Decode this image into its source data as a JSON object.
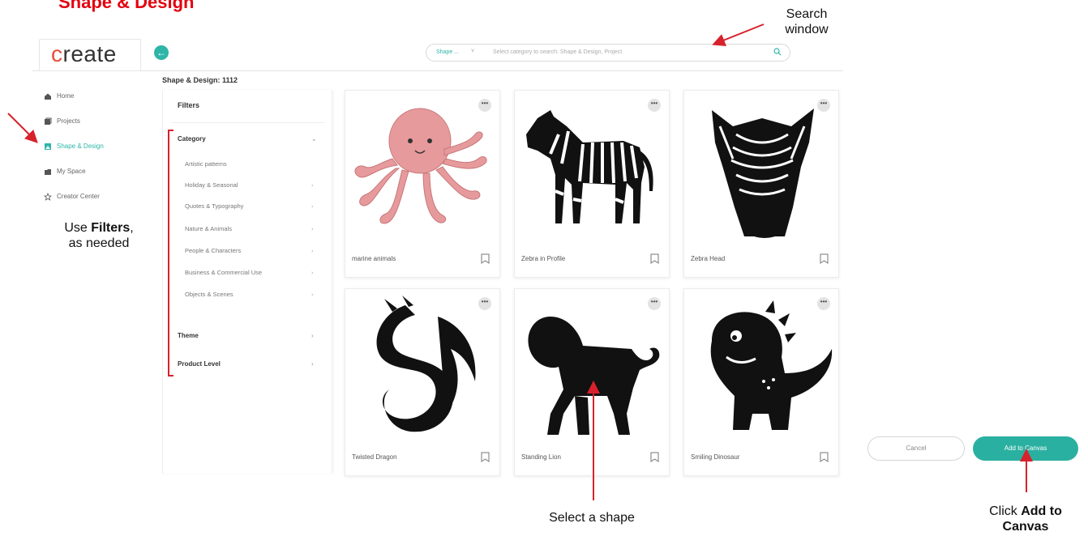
{
  "doc_title": "Shape & Design",
  "app": {
    "logo": "create",
    "search": {
      "category": "Shape ...",
      "placeholder": "Select category to search: Shape & Design, Project"
    }
  },
  "sidebar": {
    "items": [
      {
        "label": "Home",
        "icon": "home-icon"
      },
      {
        "label": "Projects",
        "icon": "projects-icon"
      },
      {
        "label": "Shape & Design",
        "icon": "shape-icon",
        "active": true
      },
      {
        "label": "My Space",
        "icon": "folder-icon"
      },
      {
        "label": "Creator Center",
        "icon": "star-icon"
      }
    ]
  },
  "breadcrumb": "Shape & Design:  1112",
  "filters": {
    "title": "Filters",
    "category_label": "Category",
    "categories": [
      "Artistic patterns",
      "Holiday & Seasonal",
      "Quotes & Typography",
      "Nature & Animals",
      "People & Characters",
      "Business & Commercial Use",
      "Objects & Scenes"
    ],
    "theme_label": "Theme",
    "product_level_label": "Product Level"
  },
  "cards": [
    {
      "name": "marine animals"
    },
    {
      "name": "Zebra in Profile"
    },
    {
      "name": "Zebra Head"
    },
    {
      "name": "Twisted Dragon"
    },
    {
      "name": "Standing Lion"
    },
    {
      "name": "Smiling Dinosaur"
    }
  ],
  "more_glyph": "•••",
  "buttons": {
    "cancel": "Cancel",
    "add": "Add to Canvas"
  },
  "annotations": {
    "search_line1": "Search",
    "search_line2": "window",
    "filters_pre": "Use ",
    "filters_bold": "Filters",
    "filters_post": ",",
    "filters_line2": "as needed",
    "select": "Select a shape",
    "click_pre": "Click ",
    "click_bold1": "Add to",
    "click_bold2": "Canvas"
  },
  "colors": {
    "accent": "#2eb5a8",
    "annotation_red": "#d7222c",
    "title_red": "#e3000f"
  }
}
